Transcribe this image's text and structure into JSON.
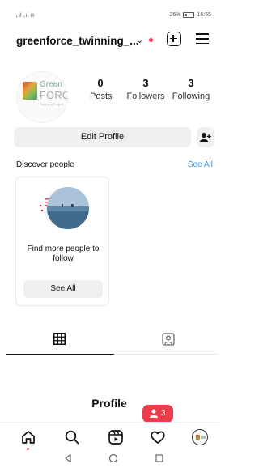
{
  "status_bar": {
    "signal": "ᵢ.ıl ᵢ.ıl ⊖",
    "battery_percent": "26%",
    "time": "16:55"
  },
  "header": {
    "username": "greenforce_twinning_...",
    "caret": "⌄"
  },
  "profile": {
    "logo": {
      "green": "Green",
      "force": "FORCE",
      "sub": "Twinning Project"
    },
    "stats": [
      {
        "value": "0",
        "label": "Posts"
      },
      {
        "value": "3",
        "label": "Followers"
      },
      {
        "value": "3",
        "label": "Following"
      }
    ],
    "edit_label": "Edit Profile"
  },
  "discover": {
    "title": "Discover people",
    "see_all": "See All",
    "card": {
      "text": "Find more people to follow",
      "button": "See All"
    }
  },
  "notification": {
    "count": "3"
  },
  "page_title": "Profile",
  "colors": {
    "accent_blue": "#2196f3",
    "notification_red": "#ec3b4b",
    "button_gray": "#efefef"
  },
  "icons": [
    "new-post-icon",
    "menu-icon",
    "add-friend-icon",
    "grid-icon",
    "tagged-icon",
    "home-icon",
    "search-icon",
    "reels-icon",
    "heart-icon",
    "profile-avatar"
  ]
}
